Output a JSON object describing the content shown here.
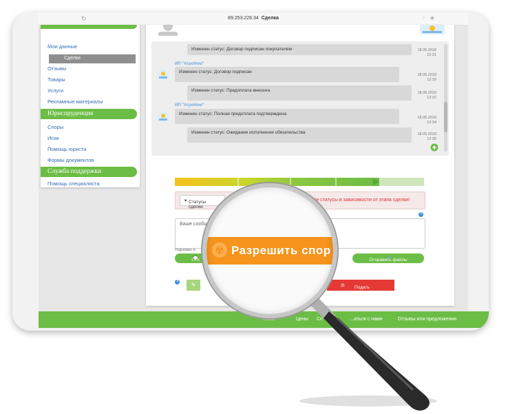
{
  "browser": {
    "address_host": "89.253.226.34",
    "address_page": "Сделка"
  },
  "sidebar": {
    "items_top": [
      {
        "label": "Мои данные"
      },
      {
        "label": "Сделки",
        "active": true
      },
      {
        "label": "Отзывы"
      },
      {
        "label": "Товары"
      },
      {
        "label": "Услуги"
      },
      {
        "label": "Рекламные материалы"
      }
    ],
    "section_law": "Юриспруденция",
    "items_law": [
      {
        "label": "Споры"
      },
      {
        "label": "Иски"
      },
      {
        "label": "Помощь юриста"
      },
      {
        "label": "Формы документов"
      }
    ],
    "section_support": "Служба поддержки",
    "items_support": [
      {
        "label": "Помощь специалиста"
      }
    ]
  },
  "chat": {
    "messages": [
      {
        "sender": "",
        "text": "Изменен статус: Договор подписан покупателем",
        "date": "18.05.2018",
        "time": "12:31",
        "side": "right"
      },
      {
        "sender": "ИП \"АгроНом\"",
        "text": "Изменен статус: Договор подписан",
        "date": "18.05.2018",
        "time": "12:32",
        "side": "left"
      },
      {
        "sender": "",
        "text": "Изменен статус: Предоплата внесена",
        "date": "18.05.2018",
        "time": "12:32",
        "side": "right"
      },
      {
        "sender": "ИП \"АгроНом\"",
        "text": "Изменен статус: Полная предоплата подтверждена",
        "date": "18.05.2018",
        "time": "12:34",
        "side": "left"
      },
      {
        "sender": "",
        "text": "Изменен статус: Ожидание исполнения обязательства",
        "date": "18.05.2018",
        "time": "12:35",
        "side": "right"
      }
    ]
  },
  "progress": {
    "value": 0.82,
    "colors": [
      "#f7c21c",
      "#b8d432",
      "#7fc24a",
      "#6cbd45"
    ]
  },
  "status": {
    "button_label": "Статусы сделки",
    "hint": "Выбирайте статусы в зависимости от этапа сделки!"
  },
  "message": {
    "placeholder": "Ваше сообще",
    "sub_label": "Подсказка: Е",
    "send_label": "Отп",
    "send_files_label": "Отправить файлы"
  },
  "actions": {
    "dispute_label": "Разрешить спор",
    "claim_label": "Подать иск"
  },
  "footer": {
    "links": [
      {
        "label": "...ние"
      },
      {
        "label": "Цены"
      },
      {
        "label": "Се"
      },
      {
        "label": "...аться с нами"
      },
      {
        "label": "Отзывы или предложения"
      }
    ]
  },
  "colors": {
    "brand_green": "#6cbd45",
    "dispute_orange": "#f7941d",
    "claim_red": "#e53935",
    "link_blue": "#2f6db5"
  }
}
